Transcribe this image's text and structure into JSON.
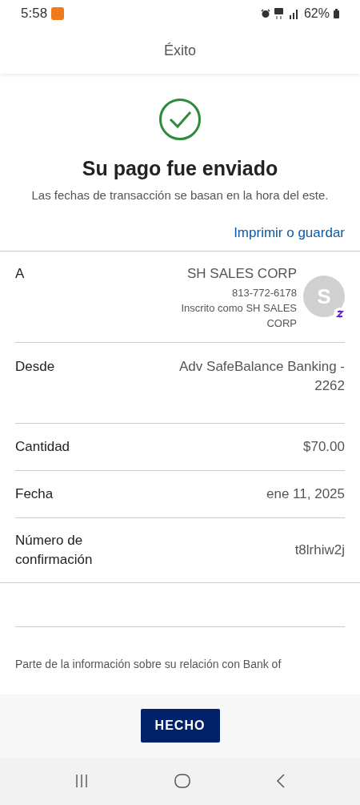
{
  "status_bar": {
    "time": "5:58",
    "battery": "62%"
  },
  "header": {
    "title": "Éxito"
  },
  "confirmation": {
    "title": "Su pago fue enviado",
    "subtitle": "Las fechas de transacción se basan en la hora del este.",
    "link": "Imprimir o guardar"
  },
  "details": [
    {
      "kind": "recipient",
      "label": "A",
      "name": "SH SALES CORP",
      "phone": "813-772-6178",
      "note": "Inscrito como SH SALES CORP",
      "avatar": "S"
    },
    {
      "kind": "plain",
      "label": "Desde",
      "value": "Adv SafeBalance Banking - 2262"
    },
    {
      "kind": "plain",
      "label": "Cantidad",
      "value": "$70.00"
    },
    {
      "kind": "plain",
      "label": "Fecha",
      "value": "ene 11, 2025"
    },
    {
      "kind": "plain",
      "label": "Número de confirmación",
      "value": "t8lrhiw2j"
    }
  ],
  "footnote": "Parte de la información sobre su relación con Bank of",
  "done_button": "HECHO"
}
